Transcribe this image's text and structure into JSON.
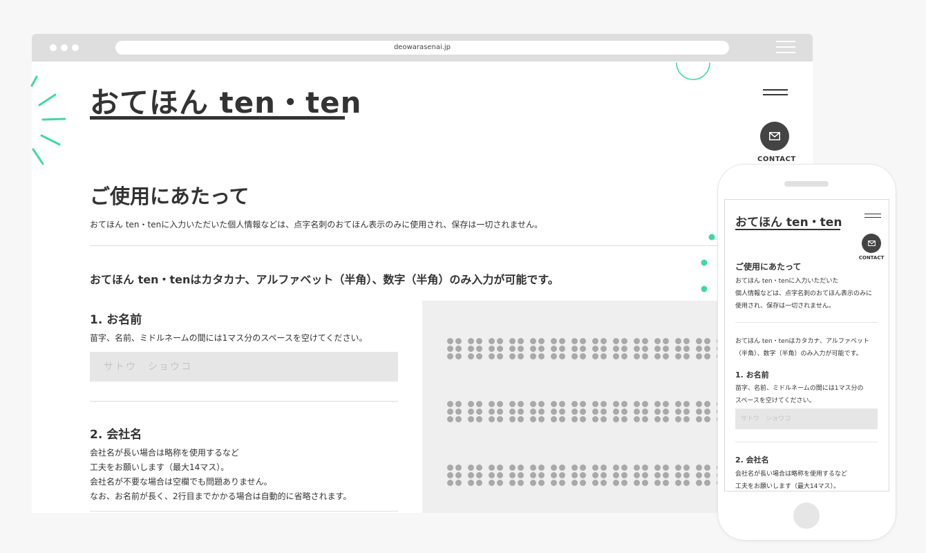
{
  "browser": {
    "url": "deowarasenai.jp"
  },
  "site": {
    "logo": "おてほん ten・ten",
    "contact_label": "CONTACT",
    "heading": "ご使用にあたって",
    "privacy_notice": "おてほん ten・tenに入力いただいた個人情報などは、点字名刺のおてほん表示のみに使用され、保存は一切されません。",
    "input_note": "おてほん ten・tenはカタカナ、アルファベット（半角）、数字（半角）のみ入力が可能です。",
    "section1": {
      "title": "1. お名前",
      "desc": "苗字、名前、ミドルネームの間には1マス分のスペースを空けてください。",
      "placeholder": "サトウ　ショウコ"
    },
    "section2": {
      "title": "2. 会社名",
      "desc_lines": [
        "会社名が長い場合は略称を使用するなど",
        "工夫をお願いします（最大14マス）。",
        "会社名が不要な場合は空欄でも問題ありません。",
        "なお、お名前が長く、2行目までかかる場合は自動的に省略されます。"
      ]
    }
  },
  "mobile": {
    "logo": "おてほん ten・ten",
    "contact_label": "CONTACT",
    "heading": "ご使用にあたって",
    "privacy_lines": [
      "おてほん ten・tenに入力いただいた",
      "個人情報などは、点字名刺のおてほん表示のみに",
      "使用され、保存は一切されません。"
    ],
    "input_note_lines": [
      "おてほん ten・tenはカタカナ、アルファベット",
      "（半角）、数字（半角）のみ入力が可能です。"
    ],
    "section1": {
      "title": "1. お名前",
      "desc_lines": [
        "苗字、名前、ミドルネームの間には1マス分の",
        "スペースを空けてください。"
      ],
      "placeholder": "サトウ　ショウコ"
    },
    "section2": {
      "title": "2. 会社名",
      "desc_lines": [
        "会社名が長い場合は略称を使用するなど",
        "工夫をお願いします（最大14マス）。"
      ]
    }
  },
  "colors": {
    "accent": "#3fd9a0",
    "dark": "#333333",
    "braille_dot": "#a9a9a9"
  },
  "icons": {
    "contact": "mail-icon",
    "menu": "hamburger-icon"
  }
}
